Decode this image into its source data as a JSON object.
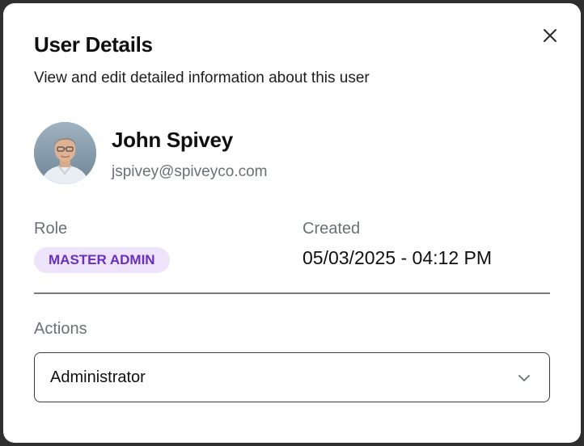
{
  "modal": {
    "title": "User Details",
    "subtitle": "View and edit detailed information about this user",
    "close_icon": "close-icon"
  },
  "user": {
    "name": "John Spivey",
    "email": "jspivey@spiveyco.com",
    "avatar_icon": "avatar-photo"
  },
  "details": {
    "role_label": "Role",
    "role_value": "MASTER ADMIN",
    "created_label": "Created",
    "created_value": "05/03/2025 - 04:12 PM"
  },
  "actions": {
    "label": "Actions",
    "selected": "Administrator",
    "chevron_icon": "chevron-down-icon"
  },
  "colors": {
    "badge_bg": "#ede4fb",
    "badge_text": "#6a2fc0",
    "muted_text": "#6b6f76"
  }
}
